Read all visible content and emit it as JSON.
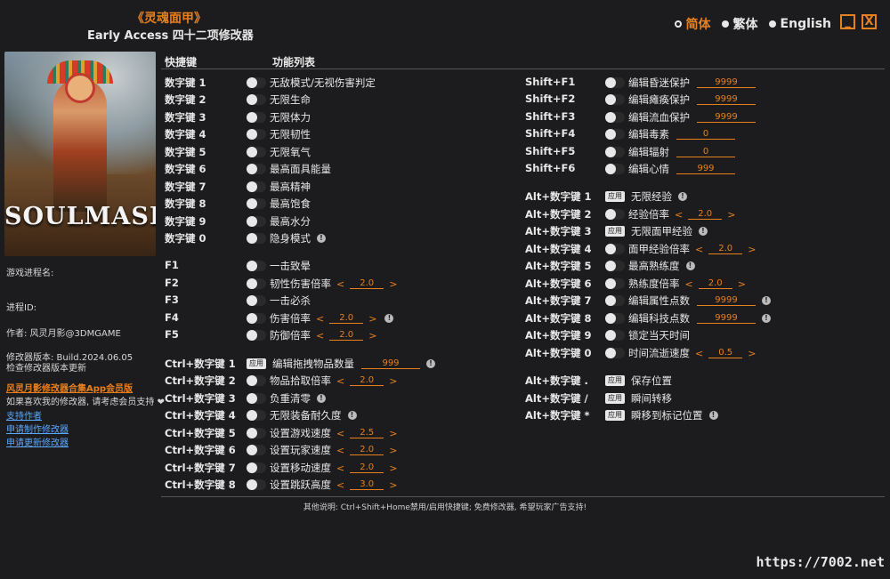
{
  "title": {
    "game": "《灵魂面甲》",
    "subtitle": "Early Access 四十二项修改器"
  },
  "languages": [
    "简体",
    "繁体",
    "English"
  ],
  "window_controls": {
    "minimize": "_",
    "close": "X"
  },
  "cover": {
    "logo_text": "SOULMASK"
  },
  "sidebar": {
    "process_label": "游戏进程名:",
    "pid_label": "进程ID:",
    "author": "作者: 风灵月影@3DMGAME",
    "version": "修改器版本: Build.2024.06.05",
    "check_update": "检查修改器版本更新",
    "app_link": "风灵月影修改器合集App会员版",
    "support_text": "如果喜欢我的修改器, 请考虑会员支持 ❤",
    "links": [
      "支持作者",
      "申请制作修改器",
      "申请更新修改器"
    ]
  },
  "headers": {
    "hotkey": "快捷键",
    "feature_list": "功能列表"
  },
  "col1": [
    {
      "key": "数字键 1",
      "type": "toggle",
      "name": "无敌模式/无视伤害判定"
    },
    {
      "key": "数字键 2",
      "type": "toggle",
      "name": "无限生命"
    },
    {
      "key": "数字键 3",
      "type": "toggle",
      "name": "无限体力"
    },
    {
      "key": "数字键 4",
      "type": "toggle",
      "name": "无限韧性"
    },
    {
      "key": "数字键 5",
      "type": "toggle",
      "name": "无限氧气"
    },
    {
      "key": "数字键 6",
      "type": "toggle",
      "name": "最高面具能量"
    },
    {
      "key": "数字键 7",
      "type": "toggle",
      "name": "最高精神"
    },
    {
      "key": "数字键 8",
      "type": "toggle",
      "name": "最高饱食"
    },
    {
      "key": "数字键 9",
      "type": "toggle",
      "name": "最高水分"
    },
    {
      "key": "数字键 0",
      "type": "toggle",
      "name": "隐身模式",
      "info": true
    },
    {
      "key": "F1",
      "type": "toggle",
      "name": "一击致晕"
    },
    {
      "key": "F2",
      "type": "toggle",
      "name": "韧性伤害倍率",
      "value": "2.0"
    },
    {
      "key": "F3",
      "type": "toggle",
      "name": "一击必杀"
    },
    {
      "key": "F4",
      "type": "toggle",
      "name": "伤害倍率",
      "value": "2.0",
      "info": true
    },
    {
      "key": "F5",
      "type": "toggle",
      "name": "防御倍率",
      "value": "2.0"
    },
    {
      "key": "Ctrl+数字键 1",
      "type": "apply",
      "name": "编辑拖拽物品数量",
      "input": "999",
      "info": true
    },
    {
      "key": "Ctrl+数字键 2",
      "type": "toggle",
      "name": "物品拾取倍率",
      "value": "2.0"
    },
    {
      "key": "Ctrl+数字键 3",
      "type": "toggle",
      "name": "负重清零",
      "info": true
    },
    {
      "key": "Ctrl+数字键 4",
      "type": "toggle",
      "name": "无限装备耐久度",
      "info": true
    },
    {
      "key": "Ctrl+数字键 5",
      "type": "toggle",
      "name": "设置游戏速度",
      "value": "2.5"
    },
    {
      "key": "Ctrl+数字键 6",
      "type": "toggle",
      "name": "设置玩家速度",
      "value": "2.0"
    },
    {
      "key": "Ctrl+数字键 7",
      "type": "toggle",
      "name": "设置移动速度",
      "value": "2.0"
    },
    {
      "key": "Ctrl+数字键 8",
      "type": "toggle",
      "name": "设置跳跃高度",
      "value": "3.0"
    }
  ],
  "col2": [
    {
      "key": "Shift+F1",
      "type": "toggle",
      "name": "编辑昏迷保护",
      "input": "9999"
    },
    {
      "key": "Shift+F2",
      "type": "toggle",
      "name": "编辑瘫痪保护",
      "input": "9999"
    },
    {
      "key": "Shift+F3",
      "type": "toggle",
      "name": "编辑流血保护",
      "input": "9999"
    },
    {
      "key": "Shift+F4",
      "type": "toggle",
      "name": "编辑毒素",
      "input": "0"
    },
    {
      "key": "Shift+F5",
      "type": "toggle",
      "name": "编辑辐射",
      "input": "0"
    },
    {
      "key": "Shift+F6",
      "type": "toggle",
      "name": "编辑心情",
      "input": "999"
    },
    {
      "key": "Alt+数字键 1",
      "type": "apply",
      "name": "无限经验",
      "info": true
    },
    {
      "key": "Alt+数字键 2",
      "type": "toggle",
      "name": "经验倍率",
      "value": "2.0"
    },
    {
      "key": "Alt+数字键 3",
      "type": "apply",
      "name": "无限面甲经验",
      "info": true
    },
    {
      "key": "Alt+数字键 4",
      "type": "toggle",
      "name": "面甲经验倍率",
      "value": "2.0"
    },
    {
      "key": "Alt+数字键 5",
      "type": "toggle",
      "name": "最高熟练度",
      "info": true
    },
    {
      "key": "Alt+数字键 6",
      "type": "toggle",
      "name": "熟练度倍率",
      "value": "2.0"
    },
    {
      "key": "Alt+数字键 7",
      "type": "toggle",
      "name": "编辑属性点数",
      "input": "9999",
      "info": true
    },
    {
      "key": "Alt+数字键 8",
      "type": "toggle",
      "name": "编辑科技点数",
      "input": "9999",
      "info": true
    },
    {
      "key": "Alt+数字键 9",
      "type": "toggle",
      "name": "锁定当天时间"
    },
    {
      "key": "Alt+数字键 0",
      "type": "toggle",
      "name": "时间流逝速度",
      "value": "0.5"
    },
    {
      "key": "Alt+数字键 .",
      "type": "apply",
      "name": "保存位置"
    },
    {
      "key": "Alt+数字键 /",
      "type": "apply",
      "name": "瞬间转移"
    },
    {
      "key": "Alt+数字键 *",
      "type": "apply",
      "name": "瞬移到标记位置",
      "info": true
    }
  ],
  "apply_label": "应用",
  "info_glyph": "!",
  "footer": "其他说明: Ctrl+Shift+Home禁用/启用快捷键; 免费修改器, 希望玩家广告支持!",
  "watermark": "https://7002.net"
}
